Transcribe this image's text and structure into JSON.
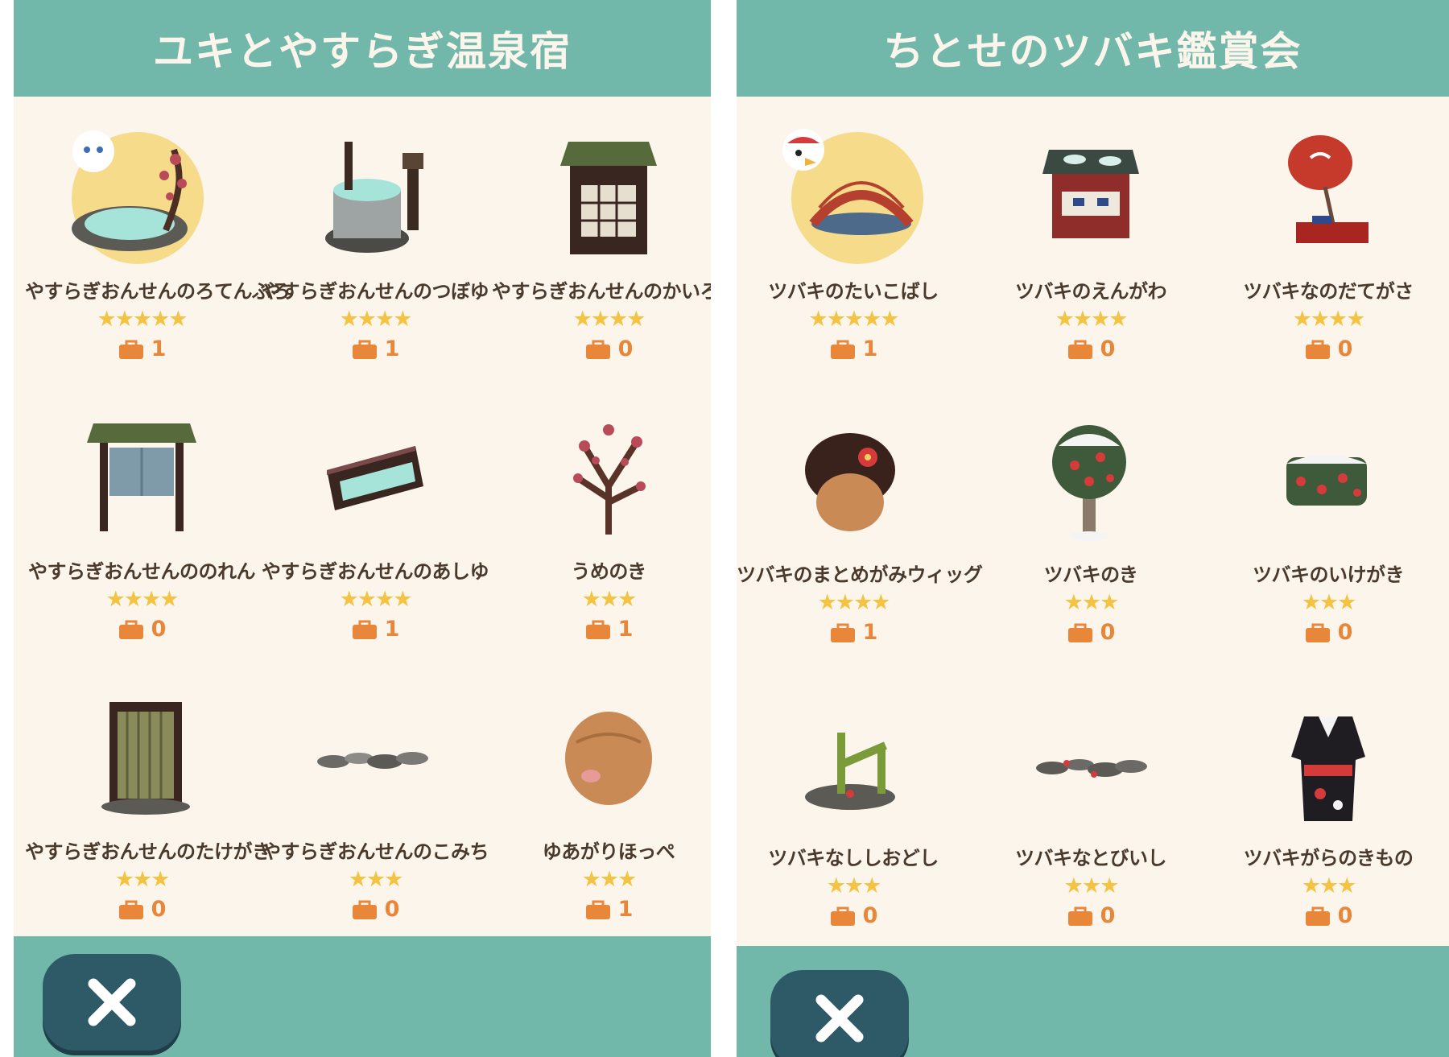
{
  "panels": [
    {
      "title": "ユキとやすらぎ温泉宿",
      "items": [
        {
          "name": "やすらぎおんせんのろてんぶろ",
          "stars": "★★★★★",
          "count": "1",
          "icon": "open-air-bath-icon"
        },
        {
          "name": "やすらぎおんせんのつぼゆ",
          "stars": "★★★★",
          "count": "1",
          "icon": "pot-bath-icon"
        },
        {
          "name": "やすらぎおんせんのかいろう",
          "stars": "★★★★",
          "count": "0",
          "icon": "corridor-icon"
        },
        {
          "name": "やすらぎおんせんののれん",
          "stars": "★★★★",
          "count": "0",
          "icon": "noren-curtain-icon"
        },
        {
          "name": "やすらぎおんせんのあしゆ",
          "stars": "★★★★",
          "count": "1",
          "icon": "foot-bath-icon"
        },
        {
          "name": "うめのき",
          "stars": "★★★",
          "count": "1",
          "icon": "plum-tree-icon"
        },
        {
          "name": "やすらぎおんせんのたけがき",
          "stars": "★★★",
          "count": "0",
          "icon": "bamboo-fence-icon"
        },
        {
          "name": "やすらぎおんせんのこみち",
          "stars": "★★★",
          "count": "0",
          "icon": "stone-path-icon"
        },
        {
          "name": "ゆあがりほっぺ",
          "stars": "★★★",
          "count": "1",
          "icon": "flushed-cheeks-head-icon"
        }
      ]
    },
    {
      "title": "ちとせのツバキ鑑賞会",
      "items": [
        {
          "name": "ツバキのたいこばし",
          "stars": "★★★★★",
          "count": "1",
          "icon": "drum-bridge-icon"
        },
        {
          "name": "ツバキのえんがわ",
          "stars": "★★★★",
          "count": "0",
          "icon": "veranda-icon"
        },
        {
          "name": "ツバキなのだてがさ",
          "stars": "★★★★",
          "count": "0",
          "icon": "parasol-icon"
        },
        {
          "name": "ツバキのまとめがみウィッグ",
          "stars": "★★★★",
          "count": "1",
          "icon": "updo-wig-icon"
        },
        {
          "name": "ツバキのき",
          "stars": "★★★",
          "count": "0",
          "icon": "camellia-tree-icon"
        },
        {
          "name": "ツバキのいけがき",
          "stars": "★★★",
          "count": "0",
          "icon": "hedge-icon"
        },
        {
          "name": "ツバキなししおどし",
          "stars": "★★★",
          "count": "0",
          "icon": "shishi-odoshi-icon"
        },
        {
          "name": "ツバキなとびいし",
          "stars": "★★★",
          "count": "0",
          "icon": "stepping-stones-icon"
        },
        {
          "name": "ツバキがらのきもの",
          "stars": "★★★",
          "count": "0",
          "icon": "kimono-icon"
        }
      ]
    }
  ],
  "colors": {
    "header": "#72b8aa",
    "panel_bg": "#fcf5ec",
    "star": "#f3c341",
    "count": "#e8873a",
    "close_button": "#2e5967"
  }
}
